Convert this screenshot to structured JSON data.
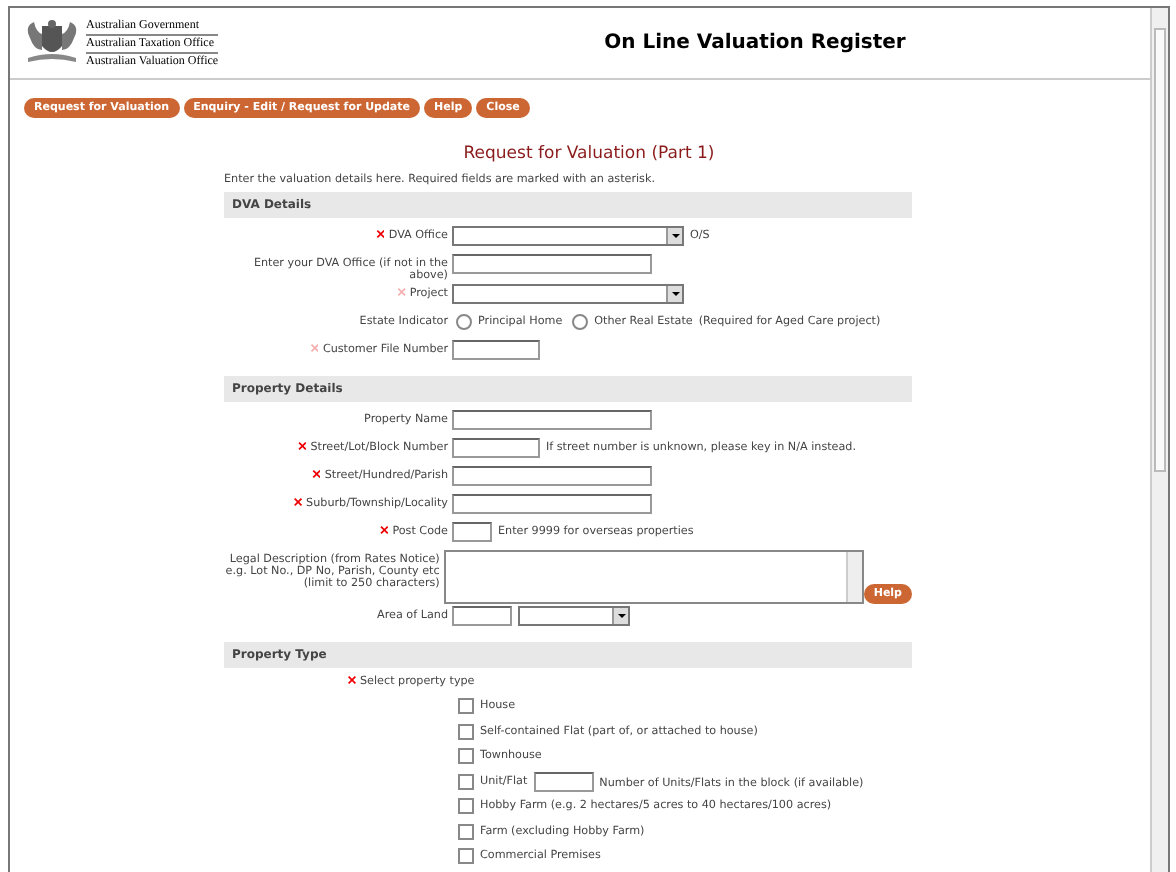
{
  "header": {
    "agencies": [
      "Australian Government",
      "Australian Taxation Office",
      "Australian Valuation Office"
    ],
    "title": "On Line Valuation Register"
  },
  "nav_buttons": [
    "Request for Valuation",
    "Enquiry - Edit / Request for Update",
    "Help",
    "Close"
  ],
  "page_title": "Request for Valuation (Part 1)",
  "intro": "Enter the valuation details here. Required fields are marked with an asterisk.",
  "sections": [
    {
      "title": "DVA Details",
      "rows": [
        {
          "kind": "select",
          "label": "DVA Office",
          "required": true,
          "muted": false,
          "suffix": "O/S"
        },
        {
          "kind": "field",
          "label": "Enter your DVA Office (if not in the above)",
          "required": false
        },
        {
          "kind": "select",
          "label": "Project",
          "required": true,
          "muted": true
        },
        {
          "kind": "radio",
          "label": "Estate Indicator",
          "required": false,
          "options": [
            {
              "label": "Principal Home",
              "selected": false
            },
            {
              "label": "Other Real Estate",
              "selected": false
            }
          ],
          "note": "(Required for Aged Care project)"
        },
        {
          "kind": "shortfield",
          "label": "Customer File Number",
          "required": true,
          "muted": true
        }
      ]
    },
    {
      "title": "Property Details",
      "rows": [
        {
          "kind": "field",
          "label": "Property Name",
          "required": false
        },
        {
          "kind": "shortfield",
          "label": "Street/Lot/Block Number",
          "required": true,
          "muted": false,
          "note": "If street number is unknown, please key in N/A instead."
        },
        {
          "kind": "field",
          "label": "Street/Hundred/Parish",
          "required": true,
          "muted": false
        },
        {
          "kind": "field",
          "label": "Suburb/Township/Locality",
          "required": true,
          "muted": false
        },
        {
          "kind": "tinyfield",
          "label": "Post Code",
          "required": true,
          "muted": false,
          "note": "Enter 9999 for overseas properties"
        },
        {
          "kind": "textarea",
          "label": "Legal Description (from Rates Notice) e.g. Lot No., DP No, Parish, County etc (limit to 250 characters)",
          "required": false,
          "help": "Help"
        },
        {
          "kind": "area",
          "label": "Area of Land",
          "required": false
        }
      ]
    },
    {
      "title": "Property Type",
      "rows": [
        {
          "kind": "heading",
          "label": "Select property type",
          "required": true,
          "muted": false
        },
        {
          "kind": "check",
          "label": "House",
          "checked": false
        },
        {
          "kind": "check",
          "label": "Self-contained Flat (part of, or attached to house)",
          "checked": false
        },
        {
          "kind": "check",
          "label": "Townhouse",
          "checked": false
        },
        {
          "kind": "check",
          "label": "Unit/Flat",
          "checked": false,
          "note": "Number of Units/Flats in the block (if available)"
        },
        {
          "kind": "check",
          "label": "Hobby Farm (e.g. 2 hectares/5 acres to 40 hectares/100 acres)",
          "checked": false
        },
        {
          "kind": "check",
          "label": "Farm (excluding Hobby Farm)",
          "checked": false
        },
        {
          "kind": "check",
          "label": "Commercial Premises",
          "checked": false
        }
      ]
    }
  ]
}
